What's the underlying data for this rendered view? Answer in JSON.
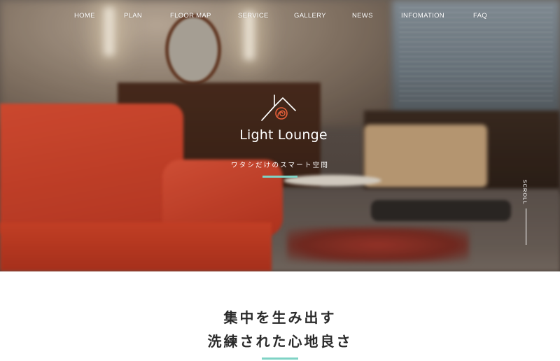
{
  "nav": {
    "items": [
      {
        "label": "HOME"
      },
      {
        "label": "PLAN"
      },
      {
        "label": "FLOOR MAP"
      },
      {
        "label": "SERVICE"
      },
      {
        "label": "GALLERY"
      },
      {
        "label": "NEWS"
      },
      {
        "label": "INFOMATION"
      },
      {
        "label": "FAQ"
      }
    ]
  },
  "hero": {
    "logo_text": "Light Lounge",
    "tagline": "ワタシだけのスマート空間",
    "scroll_label": "SCROLL",
    "logo_icon": "house-icon"
  },
  "intro": {
    "line1": "集中を生み出す",
    "line2": "洗練された心地良さ"
  },
  "colors": {
    "accent": "#7fd3c5",
    "logo_orange": "#e8603a",
    "nav_text": "#ffffff",
    "heading_text": "#2b2b2b"
  }
}
